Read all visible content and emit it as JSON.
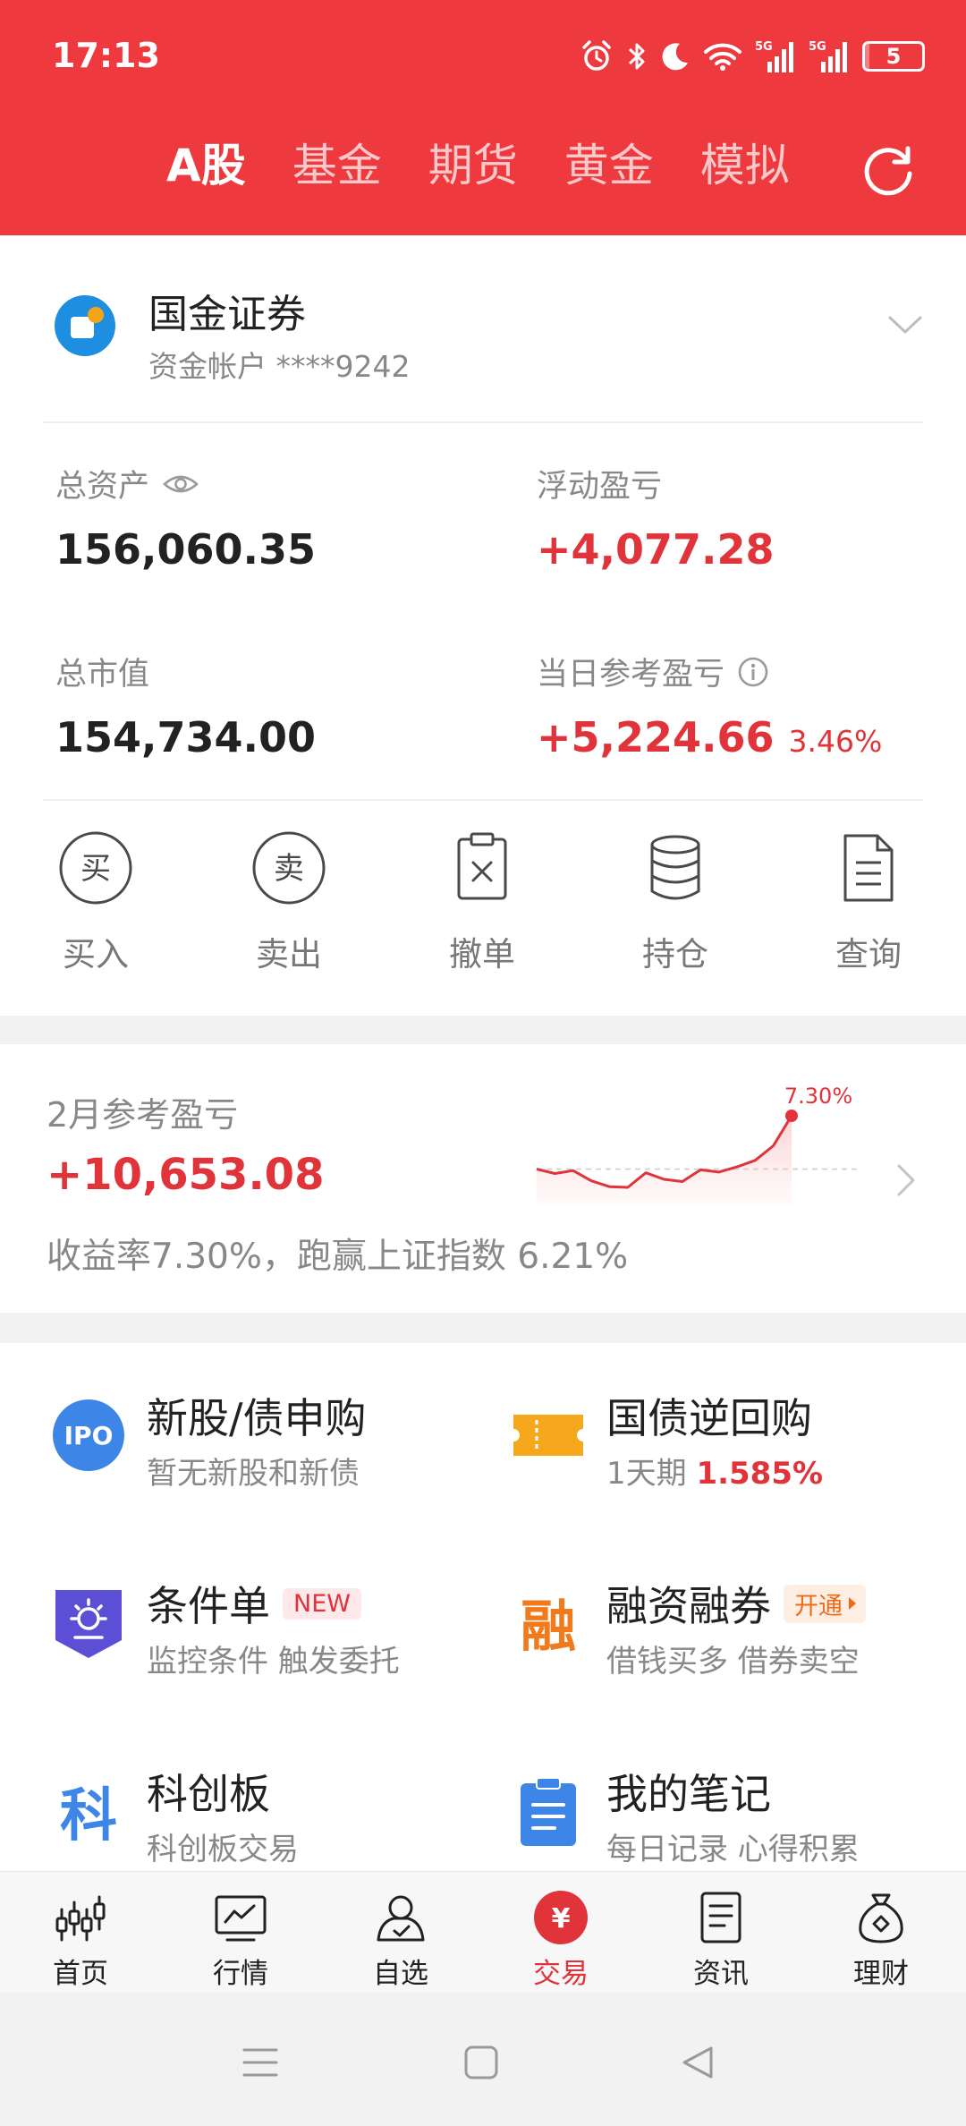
{
  "status_bar": {
    "time": "17:13",
    "icons": [
      "alarm-icon",
      "bluetooth-icon",
      "do-not-disturb-moon-icon",
      "wifi-icon",
      "signal-5g-icon",
      "signal-5g-icon"
    ],
    "signal_labels": [
      "5G",
      "5G"
    ],
    "battery_level": "5"
  },
  "header": {
    "tabs": [
      "A股",
      "基金",
      "期货",
      "黄金",
      "模拟"
    ],
    "active_tab": "A股",
    "refresh_icon": "refresh-icon"
  },
  "account": {
    "broker_name": "国金证券",
    "account_label": "资金帐户 ****9242",
    "total_assets_label": "总资产",
    "total_assets_value": "156,060.35",
    "floating_pl_label": "浮动盈亏",
    "floating_pl_value": "+4,077.28",
    "market_value_label": "总市值",
    "market_value_value": "154,734.00",
    "daily_pl_label": "当日参考盈亏",
    "daily_pl_value": "+5,224.66",
    "daily_pl_pct": "3.46%"
  },
  "actions": [
    {
      "label": "买入",
      "icon": "buy-circle-icon",
      "glyph": "买"
    },
    {
      "label": "卖出",
      "icon": "sell-circle-icon",
      "glyph": "卖"
    },
    {
      "label": "撤单",
      "icon": "cancel-order-icon"
    },
    {
      "label": "持仓",
      "icon": "position-database-icon"
    },
    {
      "label": "查询",
      "icon": "query-document-icon"
    }
  ],
  "monthly": {
    "label": "2月参考盈亏",
    "value": "+10,653.08",
    "description": "收益率7.30%，跑赢上证指数 6.21%",
    "spark_end_label": "7.30%",
    "spark_values": [
      0.0,
      -0.6,
      -0.2,
      -1.6,
      -2.4,
      -2.5,
      -0.5,
      -1.4,
      -1.7,
      -0.1,
      -0.4,
      0.3,
      1.2,
      3.2,
      7.3
    ]
  },
  "services": [
    {
      "title": "新股/债申购",
      "subtitle": "暂无新股和新债",
      "icon": "ipo-icon",
      "icon_text": "IPO"
    },
    {
      "title": "国债逆回购",
      "subtitle": "1天期",
      "subtitle_highlight": "1.585%",
      "icon": "treasury-ticket-icon"
    },
    {
      "title": "条件单",
      "subtitle": "监控条件 触发委托",
      "icon": "condition-order-sun-icon",
      "tag": "NEW"
    },
    {
      "title": "融资融券",
      "subtitle": "借钱买多 借券卖空",
      "icon": "margin-trading-icon",
      "icon_text": "融",
      "tag": "开通"
    },
    {
      "title": "科创板",
      "subtitle": "科创板交易",
      "icon": "star-market-icon",
      "icon_text": "科"
    },
    {
      "title": "我的笔记",
      "subtitle": "每日记录 心得积累",
      "icon": "notes-clipboard-icon"
    }
  ],
  "bottom_nav": [
    {
      "label": "首页",
      "icon": "home-candlestick-icon"
    },
    {
      "label": "行情",
      "icon": "market-chart-icon"
    },
    {
      "label": "自选",
      "icon": "watchlist-user-icon"
    },
    {
      "label": "交易",
      "icon": "trade-yen-icon",
      "glyph": "¥"
    },
    {
      "label": "资讯",
      "icon": "news-document-icon"
    },
    {
      "label": "理财",
      "icon": "wealth-bag-icon"
    }
  ],
  "active_nav": "交易",
  "colors": {
    "brand_red": "#ee3a3f",
    "profit_red": "#e0333a",
    "margin_orange": "#ef6b1a",
    "ipo_blue": "#3d86e8",
    "treasury_orange": "#f6a81c",
    "condition_purple": "#5b4fd6"
  }
}
